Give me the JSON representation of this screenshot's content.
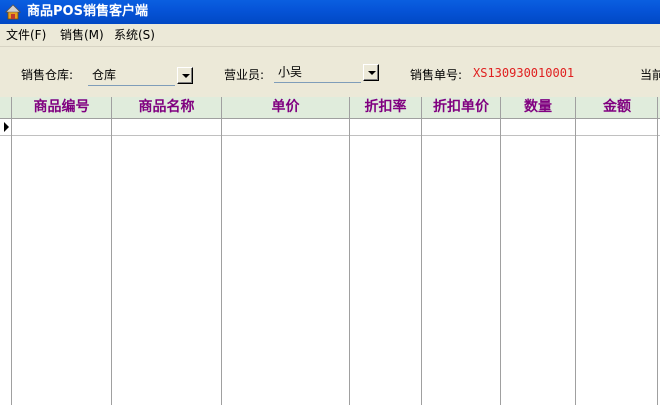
{
  "window": {
    "title": "商品POS销售客户端",
    "icon": "home-icon"
  },
  "menu": [
    {
      "label": "文件(F)"
    },
    {
      "label": "销售(M)"
    },
    {
      "label": "系统(S)"
    }
  ],
  "form": {
    "warehouse_label": "销售仓库:",
    "warehouse_value": "仓库",
    "salesperson_label": "营业员:",
    "salesperson_value": "小吴",
    "order_label": "销售单号:",
    "order_value": "XS130930010001",
    "current_label": "当前"
  },
  "table": {
    "columns": [
      "商品编号",
      "商品名称",
      "单价",
      "折扣率",
      "折扣单价",
      "数量",
      "金额"
    ],
    "rows": []
  },
  "colors": {
    "titlebar": "#0654d8",
    "header_bg": "#e0ecdc",
    "header_text": "#800080",
    "order_no": "#e02020"
  }
}
